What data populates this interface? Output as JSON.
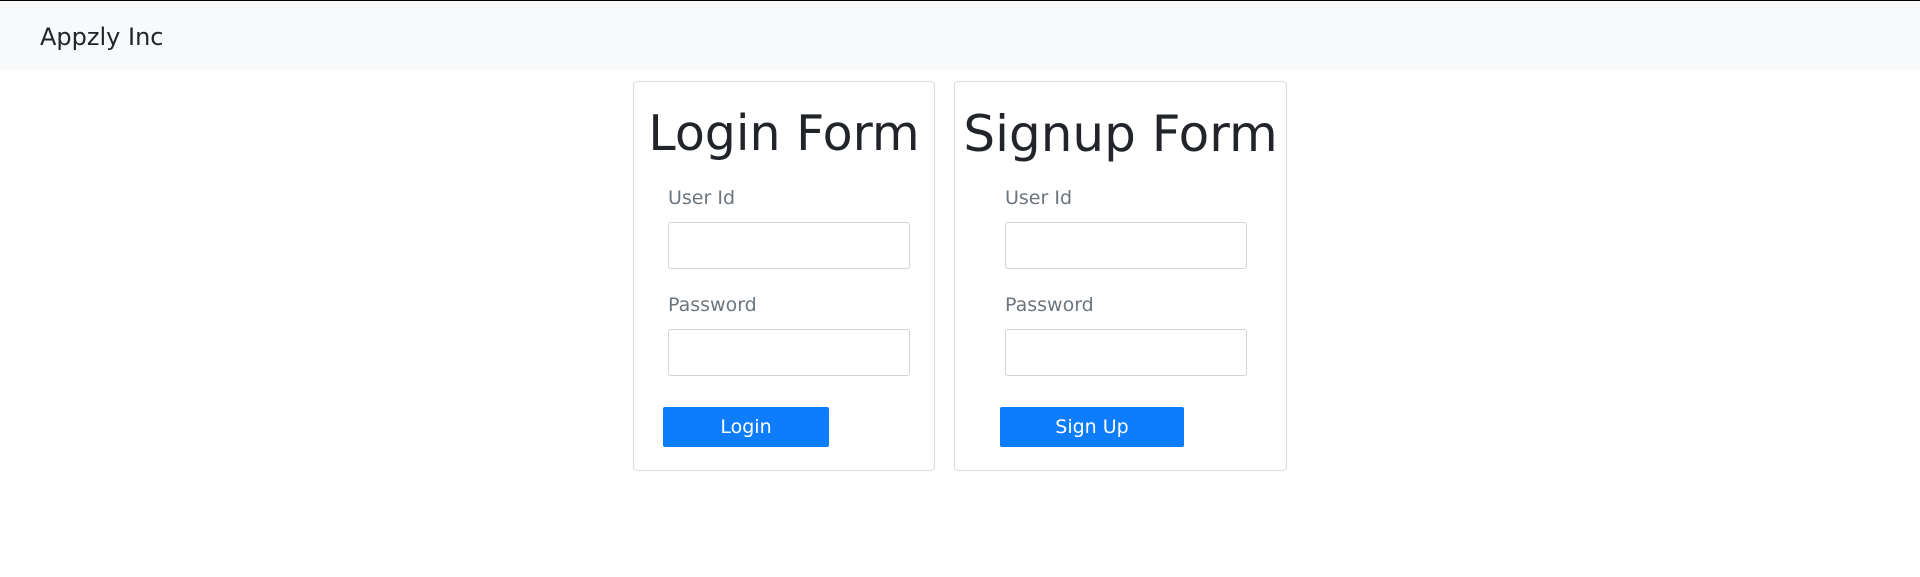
{
  "navbar": {
    "brand": "Appzly Inc"
  },
  "login_form": {
    "title": "Login Form",
    "user_id_label": "User Id",
    "user_id_value": "",
    "password_label": "Password",
    "password_value": "",
    "button_label": "Login"
  },
  "signup_form": {
    "title": "Signup Form",
    "user_id_label": "User Id",
    "user_id_value": "",
    "password_label": "Password",
    "password_value": "",
    "button_label": "Sign Up"
  },
  "colors": {
    "navbar_bg": "#f8f9fa",
    "primary_button": "#0d7dfb",
    "heading_text": "#212529",
    "label_text": "#6c757d"
  }
}
